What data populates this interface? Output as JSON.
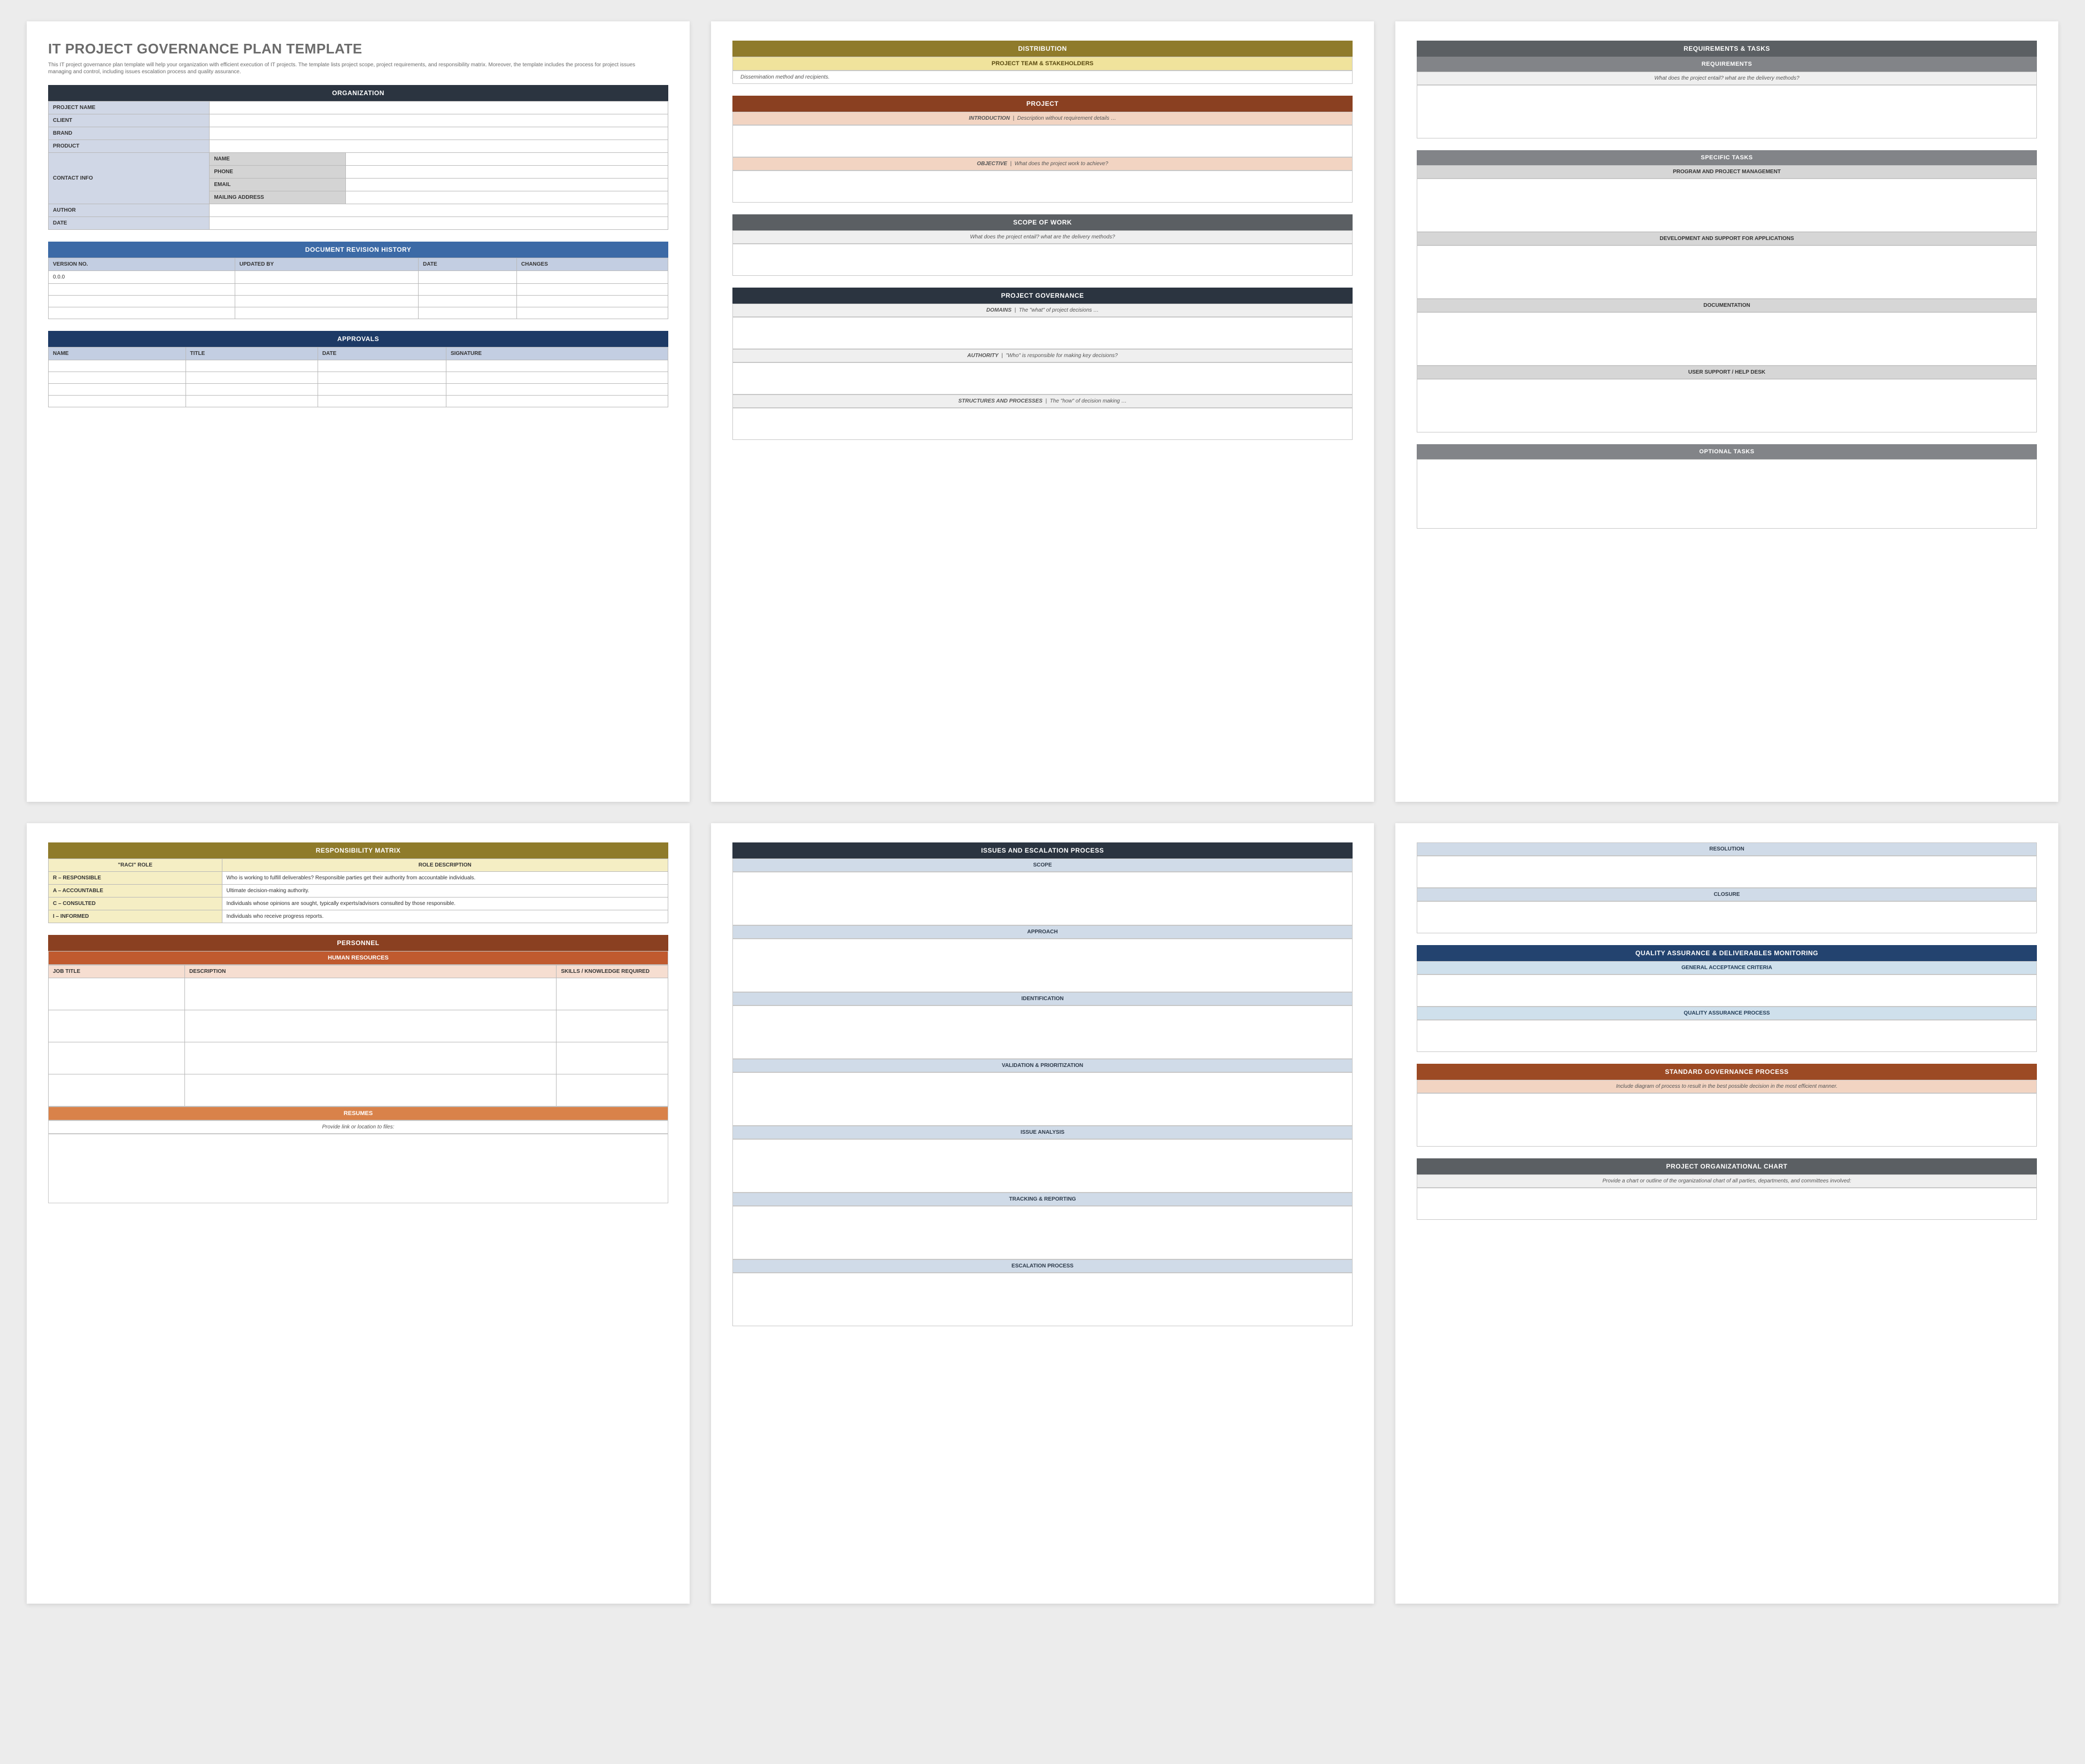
{
  "page1": {
    "title": "IT PROJECT GOVERNANCE PLAN TEMPLATE",
    "subtitle": "This IT project governance plan template will help your organization with efficient execution of IT projects. The template lists project scope, project requirements, and responsibility matrix. Moreover, the template includes the process for project issues managing and control, including issues escalation process and quality assurance.",
    "org": {
      "header": "ORGANIZATION",
      "rows": {
        "project_name": "PROJECT NAME",
        "client": "CLIENT",
        "brand": "BRAND",
        "product": "PRODUCT",
        "contact_info": "CONTACT INFO",
        "contact": {
          "name": "NAME",
          "phone": "PHONE",
          "email": "EMAIL",
          "mailing": "MAILING ADDRESS"
        },
        "author": "AUTHOR",
        "date": "DATE"
      }
    },
    "revision": {
      "header": "DOCUMENT REVISION HISTORY",
      "cols": [
        "VERSION NO.",
        "UPDATED BY",
        "DATE",
        "CHANGES"
      ],
      "first_version": "0.0.0"
    },
    "approvals": {
      "header": "APPROVALS",
      "cols": [
        "NAME",
        "TITLE",
        "DATE",
        "SIGNATURE"
      ]
    }
  },
  "page2": {
    "distribution": {
      "header": "DISTRIBUTION",
      "sub": "PROJECT TEAM & STAKEHOLDERS",
      "note": "Dissemination method and recipients."
    },
    "project": {
      "header": "PROJECT",
      "intro_label": "INTRODUCTION",
      "intro_desc": "Description without requirement details …",
      "objective_label": "OBJECTIVE",
      "objective_desc": "What does the project work to achieve?"
    },
    "scope": {
      "header": "SCOPE OF WORK",
      "note": "What does the project entail? what are the delivery methods?"
    },
    "governance": {
      "header": "PROJECT GOVERNANCE",
      "domains_label": "DOMAINS",
      "domains_desc": "The \"what\" of project decisions …",
      "authority_label": "AUTHORITY",
      "authority_desc": "\"Who\" is responsible for making key decisions?",
      "struct_label": "STRUCTURES AND PROCESSES",
      "struct_desc": "The \"how\" of decision making …"
    }
  },
  "page3": {
    "reqtasks": {
      "header": "REQUIREMENTS & TASKS",
      "req_sub": "REQUIREMENTS",
      "req_note": "What does the project entail? what are the delivery methods?",
      "specific_header": "SPECIFIC TASKS",
      "tasks": [
        "PROGRAM AND PROJECT MANAGEMENT",
        "DEVELOPMENT AND SUPPORT FOR APPLICATIONS",
        "DOCUMENTATION",
        "USER SUPPORT / HELP DESK"
      ],
      "optional_header": "OPTIONAL TASKS"
    }
  },
  "page4": {
    "matrix": {
      "header": "RESPONSIBILITY MATRIX",
      "col1": "\"RACI\" ROLE",
      "col2": "ROLE DESCRIPTION",
      "rows": [
        {
          "role": "R – RESPONSIBLE",
          "desc": "Who is working to fulfill deliverables? Responsible parties get their authority from accountable individuals."
        },
        {
          "role": "A – ACCOUNTABLE",
          "desc": "Ultimate decision-making authority."
        },
        {
          "role": "C – CONSULTED",
          "desc": "Individuals whose opinions are sought, typically experts/advisors consulted by those responsible."
        },
        {
          "role": "I – INFORMED",
          "desc": "Individuals who receive progress reports."
        }
      ]
    },
    "personnel": {
      "header": "PERSONNEL",
      "sub": "HUMAN RESOURCES",
      "cols": [
        "JOB TITLE",
        "DESCRIPTION",
        "SKILLS / KNOWLEDGE REQUIRED"
      ],
      "resumes_header": "RESUMES",
      "resumes_note": "Provide link or location to files:"
    }
  },
  "page5": {
    "issues": {
      "header": "ISSUES AND ESCALATION PROCESS",
      "sections": [
        "SCOPE",
        "APPROACH",
        "IDENTIFICATION",
        "VALIDATION & PRIORITIZATION",
        "ISSUE ANALYSIS",
        "TRACKING & REPORTING",
        "ESCALATION PROCESS"
      ]
    }
  },
  "page6": {
    "top_sections": [
      "RESOLUTION",
      "CLOSURE"
    ],
    "qa": {
      "header": "QUALITY ASSURANCE & DELIVERABLES MONITORING",
      "subs": [
        "GENERAL ACCEPTANCE CRITERIA",
        "QUALITY ASSURANCE PROCESS"
      ]
    },
    "std_process": {
      "header": "STANDARD GOVERNANCE PROCESS",
      "note": "Include diagram of process to result in the best possible decision in the most efficient manner."
    },
    "orgchart": {
      "header": "PROJECT ORGANIZATIONAL CHART",
      "note": "Provide a chart or outline of the organizational chart of all parties, departments, and committees involved:"
    }
  }
}
